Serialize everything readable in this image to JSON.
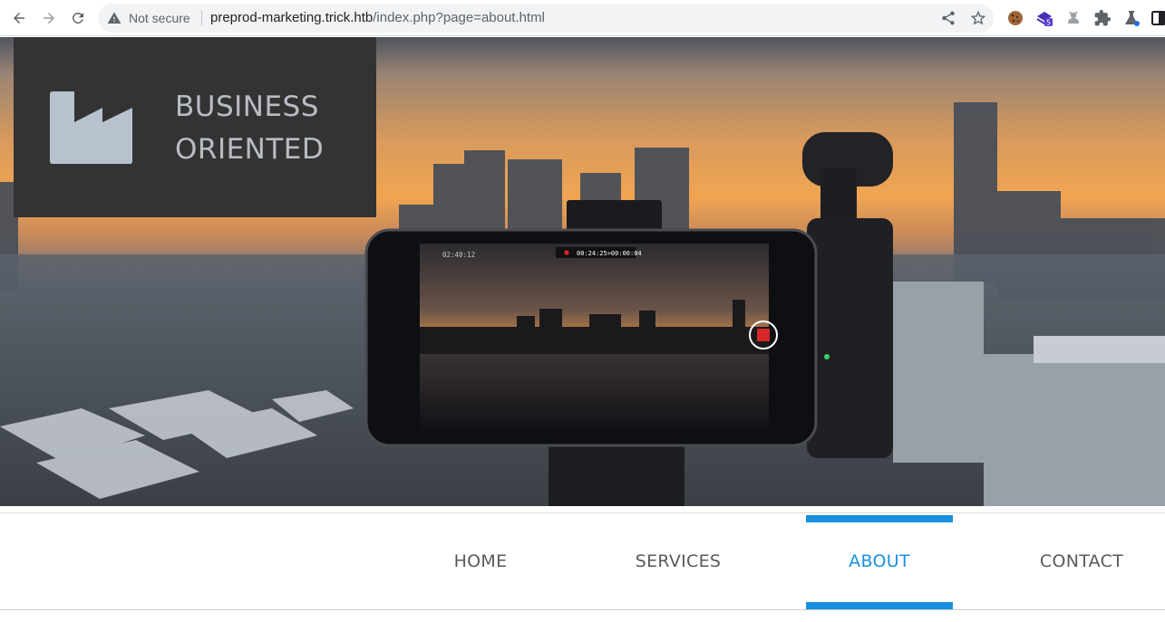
{
  "browser": {
    "security_label": "Not secure",
    "url_host": "preprod-marketing.trick.htb",
    "url_path": "/index.php?page=about.html",
    "extension_badge": "5"
  },
  "logo": {
    "line1": "BUSINESS",
    "line2": "ORIENTED"
  },
  "phone_screen": {
    "record_timer": "00:24:25>00:00:04",
    "remaining_time": "02:40:12"
  },
  "nav": {
    "items": [
      {
        "label": "HOME",
        "active": false
      },
      {
        "label": "SERVICES",
        "active": false
      },
      {
        "label": "ABOUT",
        "active": true
      },
      {
        "label": "CONTACT",
        "active": false
      }
    ]
  },
  "colors": {
    "accent": "#1a90e0",
    "logo_bg": "#333333",
    "logo_fg": "#b8bcc3"
  }
}
